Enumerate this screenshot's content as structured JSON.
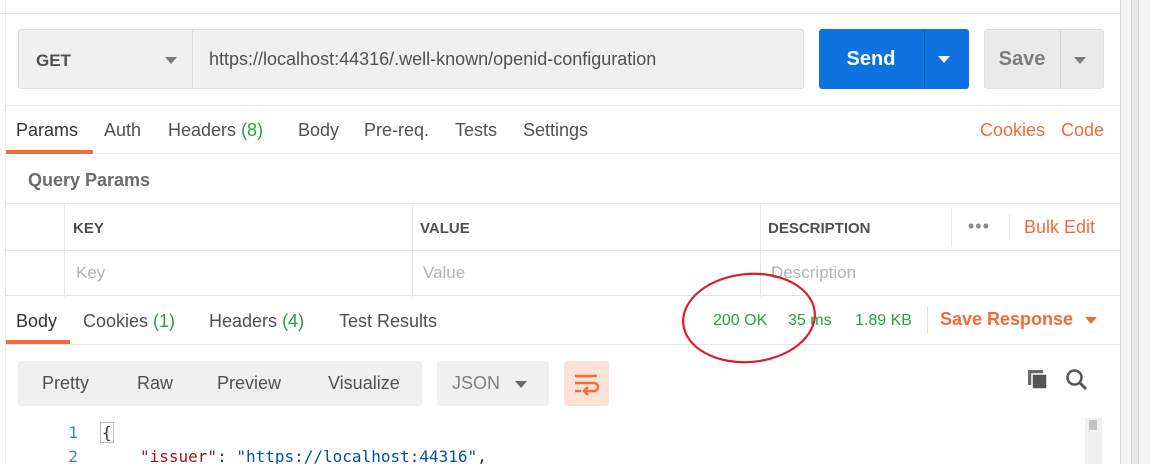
{
  "request": {
    "method": "GET",
    "url": "https://localhost:44316/.well-known/openid-configuration",
    "send_label": "Send",
    "save_label": "Save"
  },
  "request_tabs": {
    "params": "Params",
    "auth": "Auth",
    "headers": "Headers",
    "headers_count": "(8)",
    "body": "Body",
    "prereq": "Pre-req.",
    "tests": "Tests",
    "settings": "Settings",
    "cookies": "Cookies",
    "code": "Code"
  },
  "query_params": {
    "title": "Query Params",
    "columns": [
      "KEY",
      "VALUE",
      "DESCRIPTION"
    ],
    "placeholders": [
      "Key",
      "Value",
      "Description"
    ],
    "more": "•••",
    "bulk_edit": "Bulk Edit"
  },
  "response": {
    "tabs": {
      "body": "Body",
      "cookies": "Cookies",
      "cookies_count": "(1)",
      "headers": "Headers",
      "headers_count": "(4)",
      "test_results": "Test Results"
    },
    "status": "200 OK",
    "time": "35 ms",
    "size": "1.89 KB",
    "save_response": "Save Response"
  },
  "body_toolbar": {
    "view_modes": [
      "Pretty",
      "Raw",
      "Preview",
      "Visualize"
    ],
    "format": "JSON"
  },
  "code_lines": [
    {
      "number": "1",
      "text": "{"
    },
    {
      "number": "2",
      "key": "\"issuer\"",
      "value": "\"https://localhost:44316\""
    }
  ],
  "colors": {
    "accent": "#f26b3a",
    "send": "#0e73e0",
    "success": "#26a13f",
    "annotation": "#d9202a"
  },
  "icons": [
    "caret-down-icon",
    "text-wrap-icon",
    "copy-icon",
    "search-icon"
  ]
}
